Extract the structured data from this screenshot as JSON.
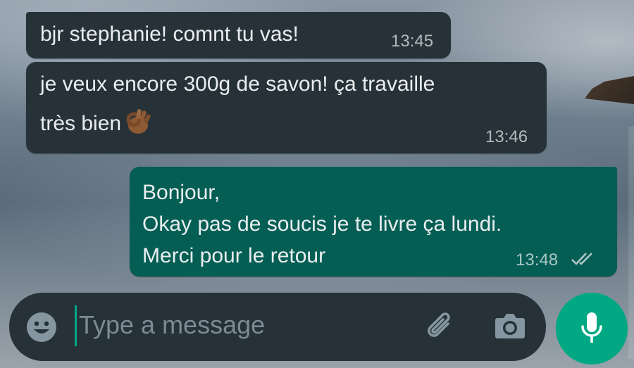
{
  "messages": [
    {
      "direction": "incoming",
      "lines": [
        "bjr stephanie! comnt tu vas!"
      ],
      "time": "13:45"
    },
    {
      "direction": "incoming",
      "lines": [
        "je veux encore 300g de savon! ça travaille",
        "très bien"
      ],
      "emoji": "ok-hand-emoji",
      "time": "13:46"
    },
    {
      "direction": "outgoing",
      "lines": [
        "Bonjour,",
        "Okay pas de soucis je te livre ça lundi.",
        "Merci pour le retour"
      ],
      "time": "13:48",
      "status_icon": "double-check-icon"
    }
  ],
  "composer": {
    "placeholder": "Type a message",
    "emoji_icon": "emoji-icon",
    "attach_icon": "paperclip-icon",
    "camera_icon": "camera-icon",
    "send_icon": "microphone-icon"
  },
  "colors": {
    "incoming_bubble": "#263238",
    "outgoing_bubble": "#055e54",
    "accent": "#00a884",
    "text": "#e9edef"
  }
}
